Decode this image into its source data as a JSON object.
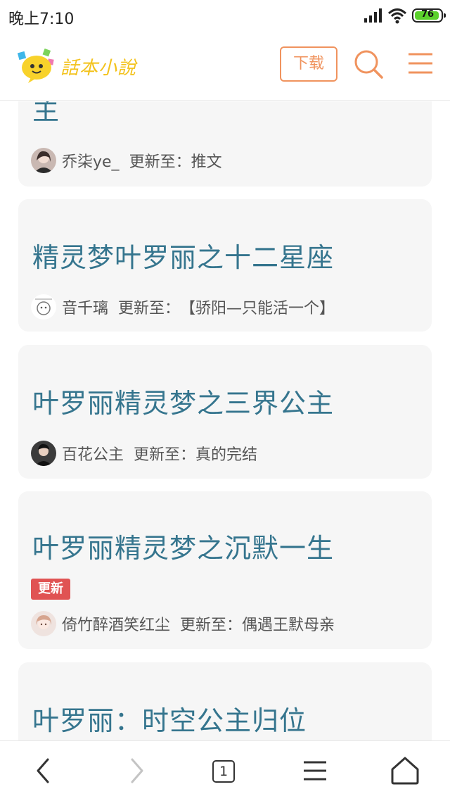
{
  "status": {
    "time": "晚上7:10",
    "battery": "76"
  },
  "header": {
    "logo_text": "話本小說",
    "download_label": "下载"
  },
  "cards": [
    {
      "title": "主",
      "author": "乔柒ye_",
      "update_label": "更新至：",
      "update_text": "推文"
    },
    {
      "title": "精灵梦叶罗丽之十二星座",
      "author": "音千璃",
      "update_label": "更新至：",
      "update_text": "【骄阳—只能活一个】"
    },
    {
      "title": "叶罗丽精灵梦之三界公主",
      "author": "百花公主",
      "update_label": "更新至：",
      "update_text": "真的完结"
    },
    {
      "title": "叶罗丽精灵梦之沉默一生",
      "badge": "更新",
      "author": "倚竹醉酒笑红尘",
      "update_label": "更新至：",
      "update_text": "偶遇王默母亲"
    },
    {
      "title": "叶罗丽：时空公主归位"
    }
  ],
  "bottom_nav": {
    "tab_count": "1"
  },
  "colors": {
    "accent": "#f0935e",
    "title": "#35758e",
    "badge": "#e05353",
    "logo": "#f3c21b"
  }
}
